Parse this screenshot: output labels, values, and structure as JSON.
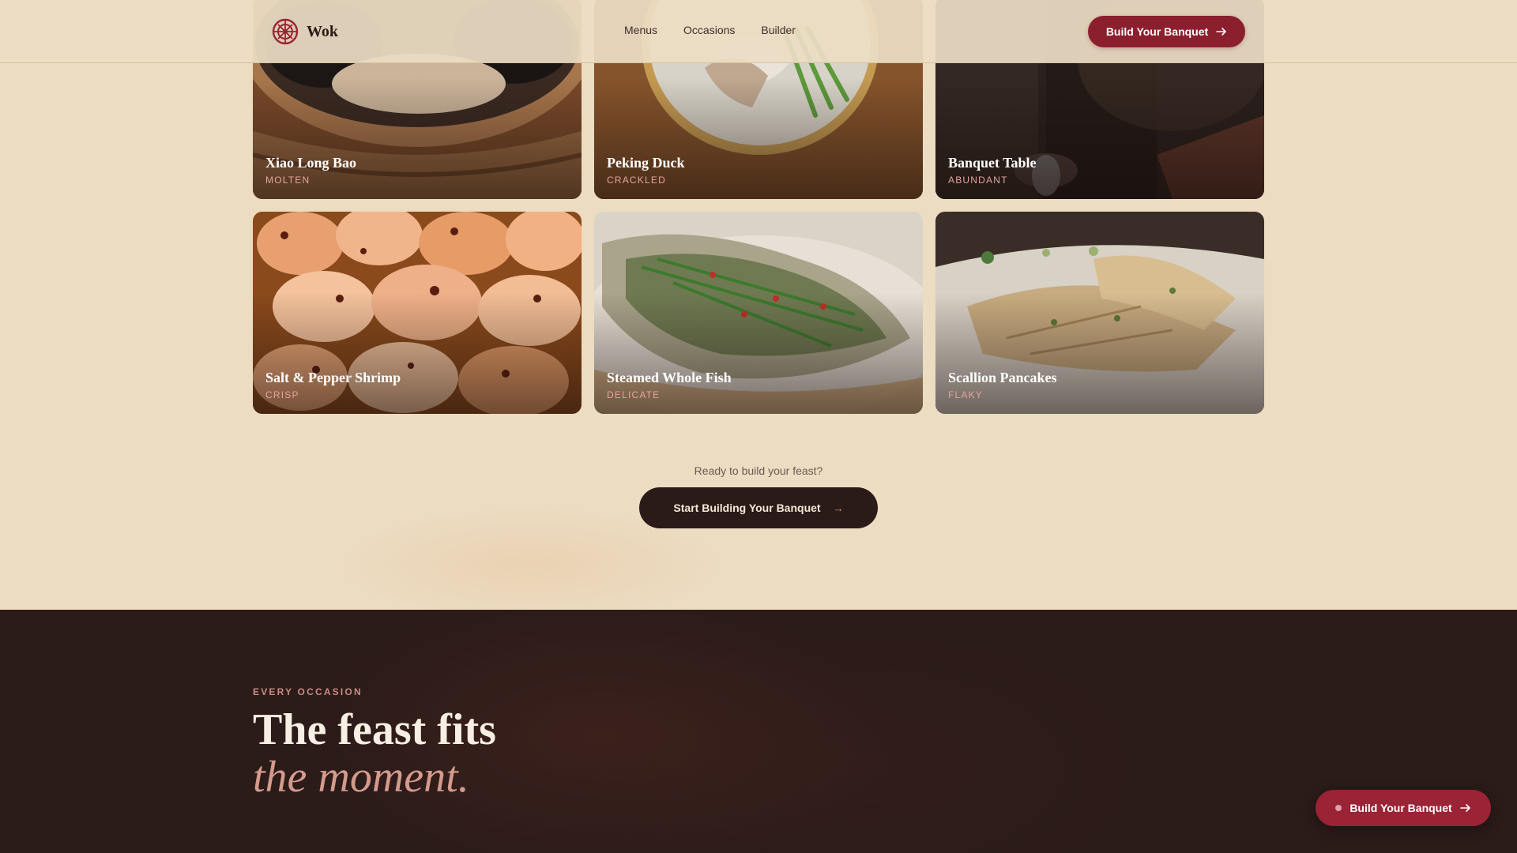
{
  "nav": {
    "brand": "Wok",
    "links": [
      "Menus",
      "Occasions",
      "Builder"
    ],
    "cta_label": "Build Your Banquet",
    "cta_icon": "arrow-right-icon",
    "logo_icon": "knot-logo-icon"
  },
  "dishes": [
    {
      "title": "Xiao Long Bao",
      "tag": "MOLTEN"
    },
    {
      "title": "Peking Duck",
      "tag": "CRACKLED"
    },
    {
      "title": "Banquet Table",
      "tag": "ABUNDANT"
    },
    {
      "title": "Salt & Pepper Shrimp",
      "tag": "CRISP"
    },
    {
      "title": "Steamed Whole Fish",
      "tag": "DELICATE"
    },
    {
      "title": "Scallion Pancakes",
      "tag": "FLAKY"
    }
  ],
  "cta": {
    "question": "Ready to build your feast?",
    "button_label": "Start Building Your Banquet",
    "button_arrow": "→"
  },
  "occasion": {
    "eyebrow": "EVERY OCCASION",
    "headline": "The feast fits",
    "headline_accent": "the moment."
  },
  "floating_cta": {
    "label": "Build Your Banquet",
    "icon": "arrow-right-icon"
  },
  "colors": {
    "page_background": "#ecdcc2",
    "brand_red": "#8c1f2e",
    "dark_section": "#2b1b19",
    "accent_rose": "#d49a8c",
    "tag_text": "#e4a39f"
  }
}
